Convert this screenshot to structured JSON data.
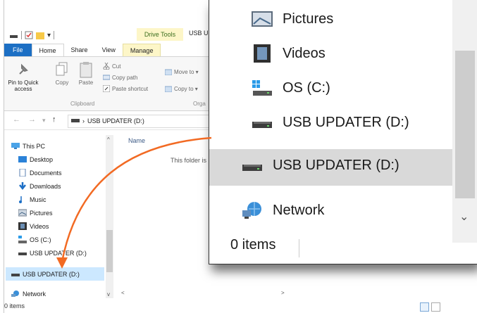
{
  "window": {
    "context_tab_label": "Drive Tools",
    "title": "USB U"
  },
  "ribbon": {
    "tabs": [
      "File",
      "Home",
      "Share",
      "View",
      "Manage"
    ],
    "pin_label_1": "Pin to Quick",
    "pin_label_2": "access",
    "copy": "Copy",
    "paste": "Paste",
    "cut": "Cut",
    "copy_path": "Copy path",
    "paste_shortcut": "Paste shortcut",
    "move_to": "Move to ▾",
    "copy_to": "Copy to ▾",
    "clipboard_group": "Clipboard",
    "organize_group": "Orga"
  },
  "address": {
    "path_sep": "›",
    "path": "USB UPDATER (D:)"
  },
  "nav": {
    "items": [
      {
        "label": "This PC",
        "icon": "pc-icon"
      },
      {
        "label": "Desktop",
        "icon": "desktop-icon"
      },
      {
        "label": "Documents",
        "icon": "documents-icon"
      },
      {
        "label": "Downloads",
        "icon": "downloads-icon"
      },
      {
        "label": "Music",
        "icon": "music-icon"
      },
      {
        "label": "Pictures",
        "icon": "pictures-icon"
      },
      {
        "label": "Videos",
        "icon": "videos-icon"
      },
      {
        "label": "OS (C:)",
        "icon": "windows-drive-icon"
      },
      {
        "label": "USB UPDATER (D:)",
        "icon": "usb-drive-icon"
      },
      {
        "label": "USB UPDATER (D:)",
        "icon": "usb-drive-icon"
      },
      {
        "label": "Network",
        "icon": "network-icon"
      }
    ]
  },
  "content": {
    "column_name": "Name",
    "empty_message": "This folder is"
  },
  "status": {
    "items": "0 items"
  },
  "zoom": {
    "items": [
      {
        "label": "Pictures",
        "icon": "pictures-icon"
      },
      {
        "label": "Videos",
        "icon": "videos-icon"
      },
      {
        "label": "OS (C:)",
        "icon": "windows-drive-icon"
      },
      {
        "label": "USB UPDATER (D:)",
        "icon": "usb-drive-icon"
      },
      {
        "label": "USB UPDATER (D:)",
        "icon": "usb-drive-icon"
      },
      {
        "label": "Network",
        "icon": "network-icon"
      }
    ],
    "status": "0 items"
  },
  "colors": {
    "accent_arrow": "#f26a23",
    "selection": "#cce8ff",
    "file_tab": "#1c6fc4"
  }
}
